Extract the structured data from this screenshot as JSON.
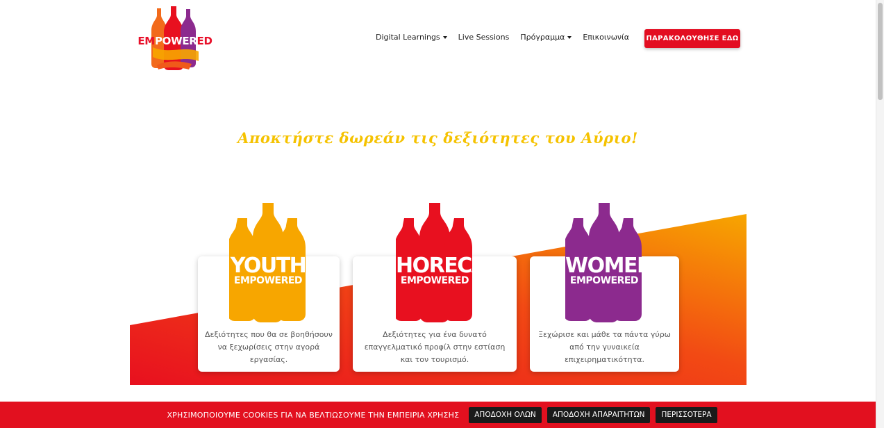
{
  "logo": {
    "part1": "EM",
    "part2": "POWER",
    "part3": "ED"
  },
  "nav": {
    "items": [
      {
        "label": "Digital Learnings",
        "dropdown": true
      },
      {
        "label": "Live Sessions",
        "dropdown": false
      },
      {
        "label": "Πρόγραμμα",
        "dropdown": true
      },
      {
        "label": "Επικοινωνία",
        "dropdown": false
      }
    ],
    "cta": "ΠΑΡΑΚΟΛΟΥΘΗΣΕ ΕΔΩ"
  },
  "headline": "Αποκτήστε δωρεάν τις δεξιότητες του Αύριο!",
  "cards": [
    {
      "brand_top": "YOUTH",
      "brand_bottom": "EMPOWERED",
      "color": "#f7a600",
      "text": "Δεξιότητες που θα σε βοηθήσουν να ξεχωρίσεις στην αγορά εργασίας."
    },
    {
      "brand_top": "HORECA",
      "brand_bottom": "EMPOWERED",
      "color": "#e8101f",
      "text": "Δεξιότητες για ένα δυνατό επαγγελματικό προφίλ στην εστίαση και τον τουρισμό."
    },
    {
      "brand_top": "WOMEN",
      "brand_bottom": "EMPOWERED",
      "color": "#8c2a8e",
      "text": "Ξεχώρισε και μάθε τα πάντα γύρω από την γυναικεία επιχειρηματικότητα."
    }
  ],
  "cookie": {
    "text": "ΧΡΗΣΙΜΟΠΟΙΟΥΜΕ COOKIES ΓΙΑ ΝΑ ΒΕΛΤΙΩΣΟΥΜΕ ΤΗΝ ΕΜΠΕΙΡΙΑ ΧΡΗΣΗΣ",
    "accept_all": "ΑΠΟΔΟΧΗ ΟΛΩΝ",
    "accept_necessary": "ΑΠΟΔΟΧΗ ΑΠΑΡΑΙΤΗΤΩΝ",
    "more": "ΠΕΡΙΣΣΟΤΕΡΑ"
  },
  "colors": {
    "accent_red": "#e30d21",
    "headline_yellow": "#f5c200",
    "youth": "#f7a600",
    "horeca": "#e8101f",
    "women": "#8c2a8e"
  }
}
